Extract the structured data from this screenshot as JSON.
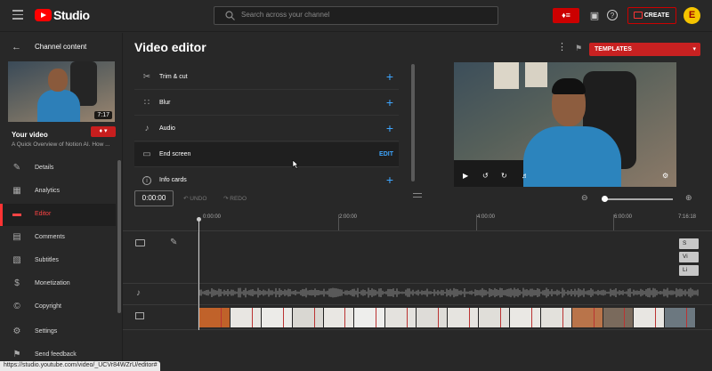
{
  "header": {
    "logo_text": "Studio",
    "search_placeholder": "Search across your channel",
    "create_label": "CREATE",
    "avatar_letter": "E"
  },
  "sidebar": {
    "back_label": "Channel content",
    "video_duration": "7:17",
    "your_video_label": "Your video",
    "video_title": "A Quick Overview of Notion AI. How ...",
    "items": [
      {
        "label": "Details",
        "icon": "pencil-icon"
      },
      {
        "label": "Analytics",
        "icon": "analytics-icon"
      },
      {
        "label": "Editor",
        "icon": "editor-icon",
        "active": true
      },
      {
        "label": "Comments",
        "icon": "comments-icon"
      },
      {
        "label": "Subtitles",
        "icon": "subtitles-icon"
      },
      {
        "label": "Monetization",
        "icon": "monetization-icon"
      },
      {
        "label": "Copyright",
        "icon": "copyright-icon"
      },
      {
        "label": "Settings",
        "icon": "gear-icon"
      },
      {
        "label": "Send feedback",
        "icon": "feedback-icon"
      }
    ]
  },
  "main": {
    "title": "Video editor",
    "templates_label": "TEMPLATES",
    "tools": [
      {
        "label": "Trim & cut",
        "icon": "scissors-icon",
        "action": "+"
      },
      {
        "label": "Blur",
        "icon": "blur-icon",
        "action": "+"
      },
      {
        "label": "Audio",
        "icon": "music-note-icon",
        "action": "+"
      },
      {
        "label": "End screen",
        "icon": "end-screen-icon",
        "action": "EDIT"
      },
      {
        "label": "Info cards",
        "icon": "info-icon",
        "action": "+"
      }
    ]
  },
  "timeline": {
    "current_time": "0:00:00",
    "undo_label": "UNDO",
    "redo_label": "REDO",
    "ticks": [
      "0:00:00",
      "2:00:00",
      "4:00:00",
      "6:00:00",
      "7:16:18"
    ],
    "end_screen_chips": [
      "S",
      "Vi",
      "Li"
    ]
  },
  "status_url": "https://studio.youtube.com/video/_UCVr84WZrU/editor#",
  "colors": {
    "accent_red": "#cc0000",
    "link_blue": "#3ea6ff",
    "bg": "#282828"
  }
}
